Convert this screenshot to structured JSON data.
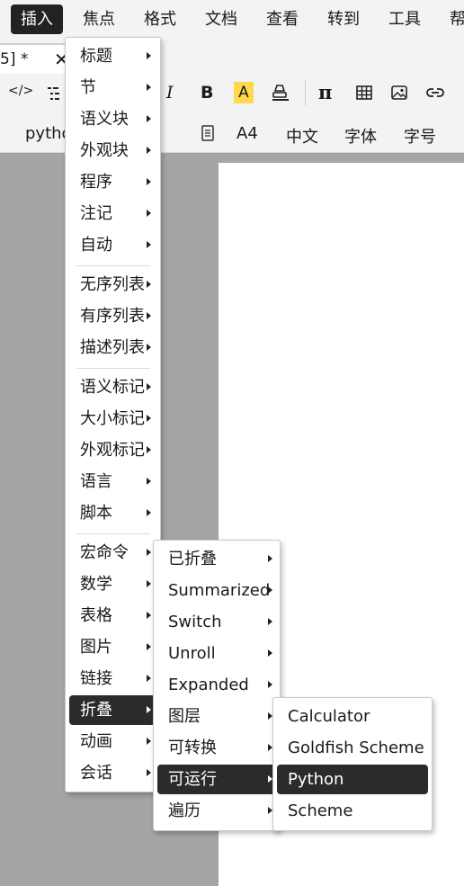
{
  "menubar": {
    "items": [
      {
        "label": "插入",
        "active": true
      },
      {
        "label": "焦点"
      },
      {
        "label": "格式"
      },
      {
        "label": "文档"
      },
      {
        "label": "查看"
      },
      {
        "label": "转到"
      },
      {
        "label": "工具"
      },
      {
        "label": "帮"
      }
    ]
  },
  "tab": {
    "title": "5] *",
    "close": "✕"
  },
  "toolbar": {
    "code_label": "</>",
    "mode_label": "pytho",
    "italic": "I",
    "bold": "B",
    "highlight": "A",
    "pi": "π",
    "paper": "A4",
    "lang": "中文",
    "font": "字体",
    "fontsize": "字号"
  },
  "menu_insert": {
    "items": [
      "标题",
      "节",
      "语义块",
      "外观块",
      "程序",
      "注记",
      "自动",
      "无序列表",
      "有序列表",
      "描述列表",
      "语义标记",
      "大小标记",
      "外观标记",
      "语言",
      "脚本",
      "宏命令",
      "数学",
      "表格",
      "图片",
      "链接",
      "折叠",
      "动画",
      "会话"
    ],
    "highlighted": "折叠"
  },
  "menu_fold": {
    "items": [
      "已折叠",
      "Summarized",
      "Switch",
      "Unroll",
      "Expanded",
      "图层",
      "可转换",
      "可运行",
      "遍历"
    ],
    "highlighted": "可运行"
  },
  "menu_runnable": {
    "items": [
      "Calculator",
      "Goldfish Scheme",
      "Python",
      "Scheme"
    ],
    "highlighted": "Python"
  },
  "colors": {
    "highlight_bg": "#2b2b2b",
    "canvas_gray": "#a5a5a5",
    "highlight_yellow": "#ffd84d"
  }
}
